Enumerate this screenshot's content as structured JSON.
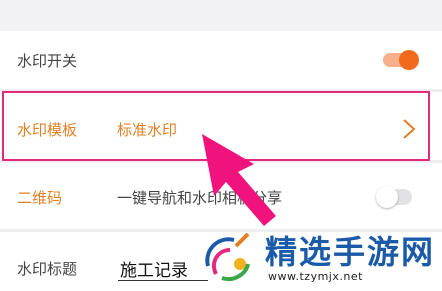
{
  "rows": {
    "watermark_switch": {
      "label": "水印开关",
      "enabled": true
    },
    "watermark_template": {
      "label": "水印模板",
      "value": "标准水印"
    },
    "qr_code": {
      "label": "二维码",
      "description": "一键导航和水印相机分享",
      "enabled": false
    },
    "watermark_title": {
      "label": "水印标题",
      "value": "施工记录"
    }
  },
  "overlay_watermark": {
    "title": "精选手游网",
    "url": "www.tzymjx.net"
  },
  "colors": {
    "accent_orange": "#e07f23",
    "toggle_on": "#f26a1b",
    "highlight_pink": "#e4287d",
    "arrow_pink": "#f0137d",
    "watermark_blue": "#1b5aa8"
  }
}
